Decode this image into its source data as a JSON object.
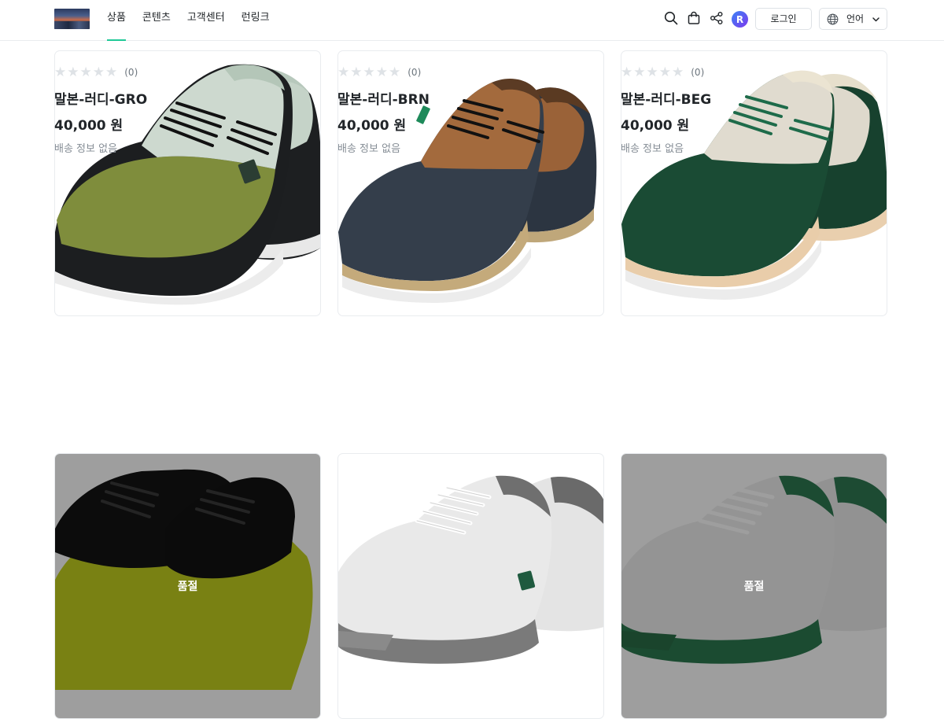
{
  "header": {
    "nav": [
      {
        "label": "상품",
        "active": true
      },
      {
        "label": "콘텐츠",
        "active": false
      },
      {
        "label": "고객센터",
        "active": false
      },
      {
        "label": "런링크",
        "active": false
      }
    ],
    "icons": [
      "search-icon",
      "shopping-bag-icon",
      "share-icon"
    ],
    "avatar_letter": "R",
    "login_label": "로그인",
    "language_label": "언어",
    "accent_color": "#20c997"
  },
  "products": [
    {
      "name": "말본-러디-GRO",
      "price": "40,000 원",
      "shipping": "배송 정보 없음",
      "review_count": "(0)",
      "rating": 0,
      "sold_out": false
    },
    {
      "name": "말본-러디-BRN",
      "price": "40,000 원",
      "shipping": "배송 정보 없음",
      "review_count": "(0)",
      "rating": 0,
      "sold_out": false
    },
    {
      "name": "말본-러디-BEG",
      "price": "40,000 원",
      "shipping": "배송 정보 없음",
      "review_count": "(0)",
      "rating": 0,
      "sold_out": false
    },
    {
      "sold_out": true,
      "sold_out_label": "품절"
    },
    {
      "sold_out": false
    },
    {
      "sold_out": true,
      "sold_out_label": "품절"
    }
  ]
}
